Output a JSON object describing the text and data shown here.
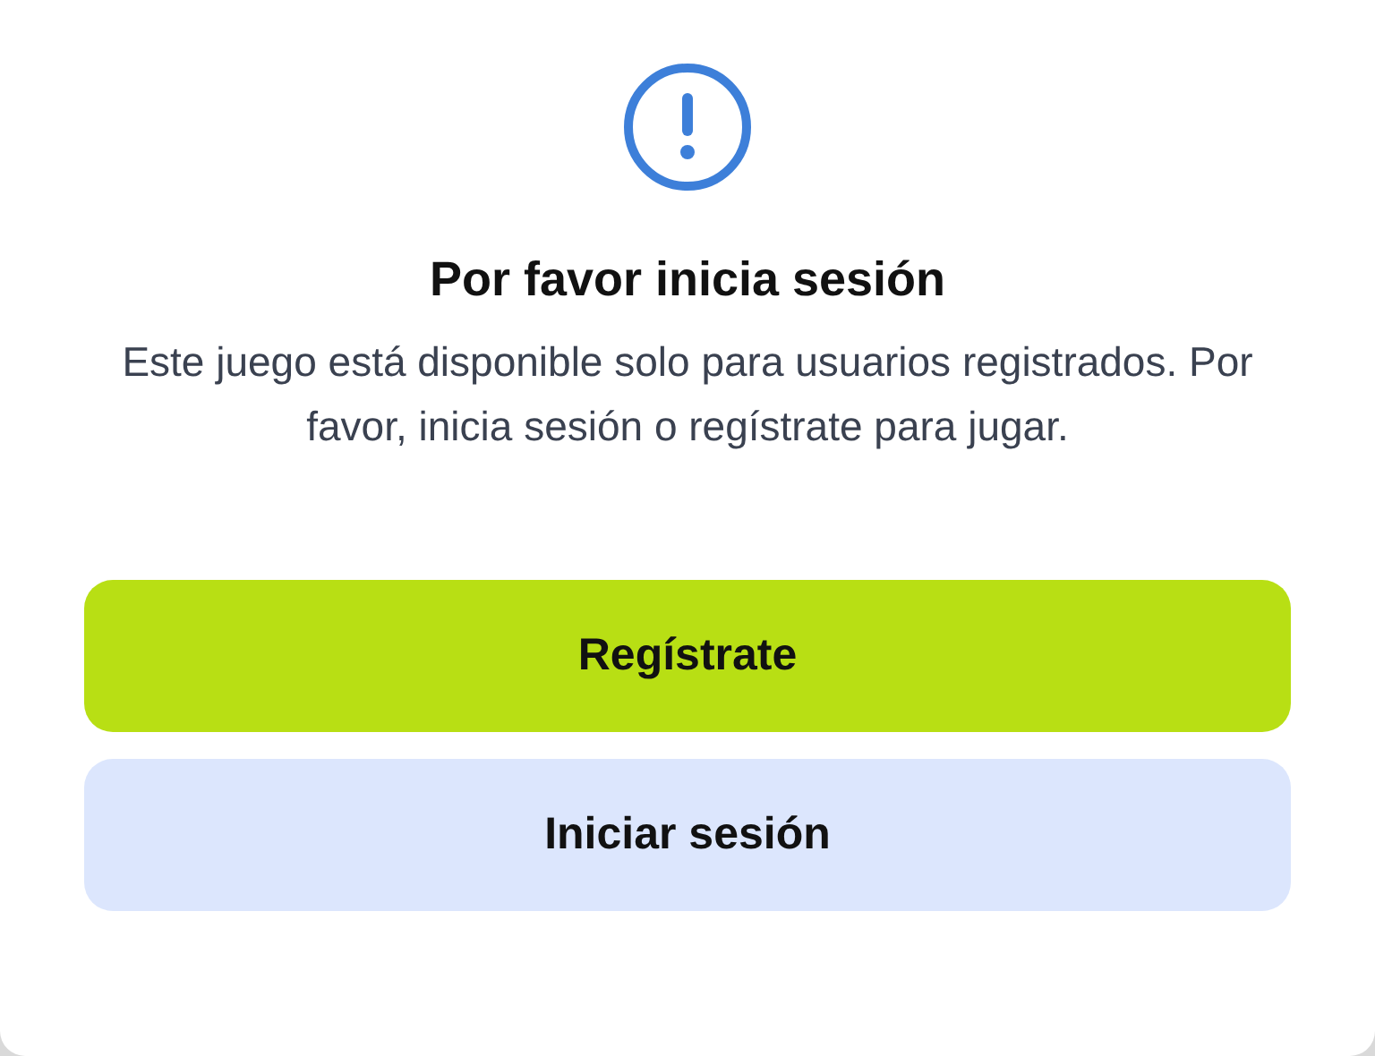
{
  "dialog": {
    "title": "Por favor inicia sesión",
    "message": "Este juego está disponible solo para usuarios registrados. Por favor, inicia sesión o regístrate para jugar.",
    "buttons": [
      {
        "label": "Regístrate",
        "kind": "primary"
      },
      {
        "label": "Iniciar sesión",
        "kind": "secondary"
      }
    ]
  }
}
